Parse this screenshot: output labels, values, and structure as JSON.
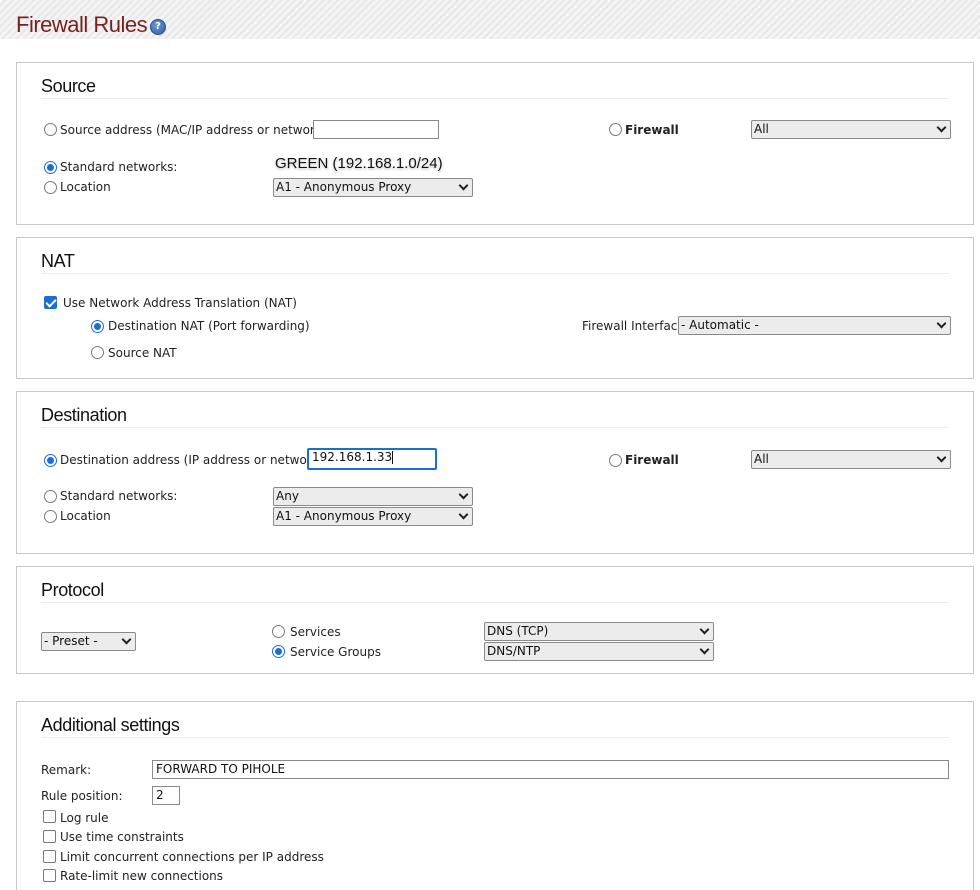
{
  "header": {
    "title": "Firewall Rules",
    "help_icon": "help-icon"
  },
  "source": {
    "title": "Source",
    "address_label": "Source address (MAC/IP address or network):",
    "address_value": "",
    "firewall_label": "Firewall",
    "firewall_select": "All",
    "standard_networks_label": "Standard networks:",
    "standard_networks_value": "GREEN (192.168.1.0/24)",
    "location_label": "Location",
    "location_select": "A1 - Anonymous Proxy"
  },
  "nat": {
    "title": "NAT",
    "use_nat_label": "Use Network Address Translation (NAT)",
    "dnat_label": "Destination NAT (Port forwarding)",
    "snat_label": "Source NAT",
    "interface_label": "Firewall Interface:",
    "interface_select": "- Automatic -"
  },
  "destination": {
    "title": "Destination",
    "address_label": "Destination address (IP address or network):",
    "address_value": "192.168.1.33",
    "firewall_label": "Firewall",
    "firewall_select": "All",
    "standard_networks_label": "Standard networks:",
    "standard_networks_select": "Any",
    "location_label": "Location",
    "location_select": "A1 - Anonymous Proxy"
  },
  "protocol": {
    "title": "Protocol",
    "preset_select": "- Preset -",
    "services_label": "Services",
    "services_select": "DNS (TCP)",
    "service_groups_label": "Service Groups",
    "service_groups_select": "DNS/NTP"
  },
  "additional": {
    "title": "Additional settings",
    "remark_label": "Remark:",
    "remark_value": "FORWARD TO PIHOLE",
    "rule_position_label": "Rule position:",
    "rule_position_value": "2",
    "log_rule_label": "Log rule",
    "time_constraints_label": "Use time constraints",
    "limit_concurrent_label": "Limit concurrent connections per IP address",
    "rate_limit_label": "Rate-limit new connections"
  },
  "colors": {
    "title": "#7a1f1f",
    "accent": "#1b6fd1"
  }
}
